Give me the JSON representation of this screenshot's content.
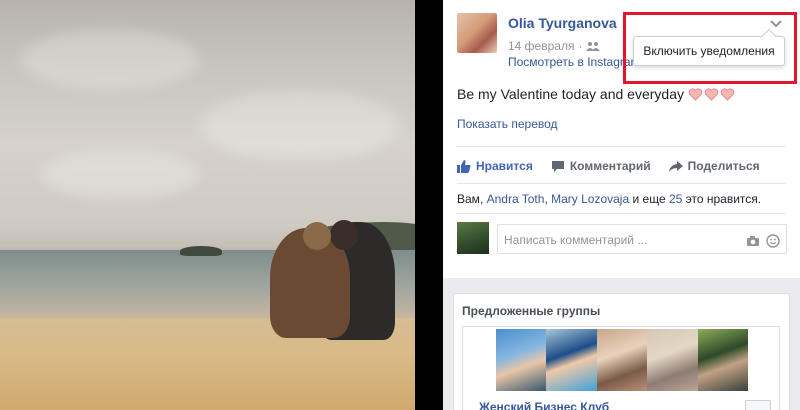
{
  "post": {
    "author": "Olia Tyurganova",
    "date": "14 февраля",
    "dot": "·",
    "via": "Посмотреть в Instagram",
    "text": "Be my Valentine today and everyday",
    "translate": "Показать перевод"
  },
  "menu": {
    "item": "Включить уведомления"
  },
  "actions": {
    "like": "Нравится",
    "comment": "Комментарий",
    "share": "Поделиться"
  },
  "likes": {
    "you": "Вам",
    "sep1": ", ",
    "name1": "Andra Toth",
    "sep2": ", ",
    "name2": "Mary Lozovaja",
    "and_more": " и еще ",
    "count": "25",
    "suffix": " это нравится."
  },
  "comment": {
    "placeholder": "Написать комментарий ..."
  },
  "suggested": {
    "title": "Предложенные группы",
    "group_name": "Женский Бизнес Клуб"
  },
  "colors": {
    "link": "#365899",
    "like_active": "#4267b2",
    "highlight": "#e0162b",
    "heart": "#f4a7a7"
  },
  "icons": [
    "friends-icon",
    "chevron-down-icon",
    "heart-icon",
    "thumbs-up-icon",
    "comment-icon",
    "share-icon",
    "camera-icon",
    "smiley-icon"
  ]
}
